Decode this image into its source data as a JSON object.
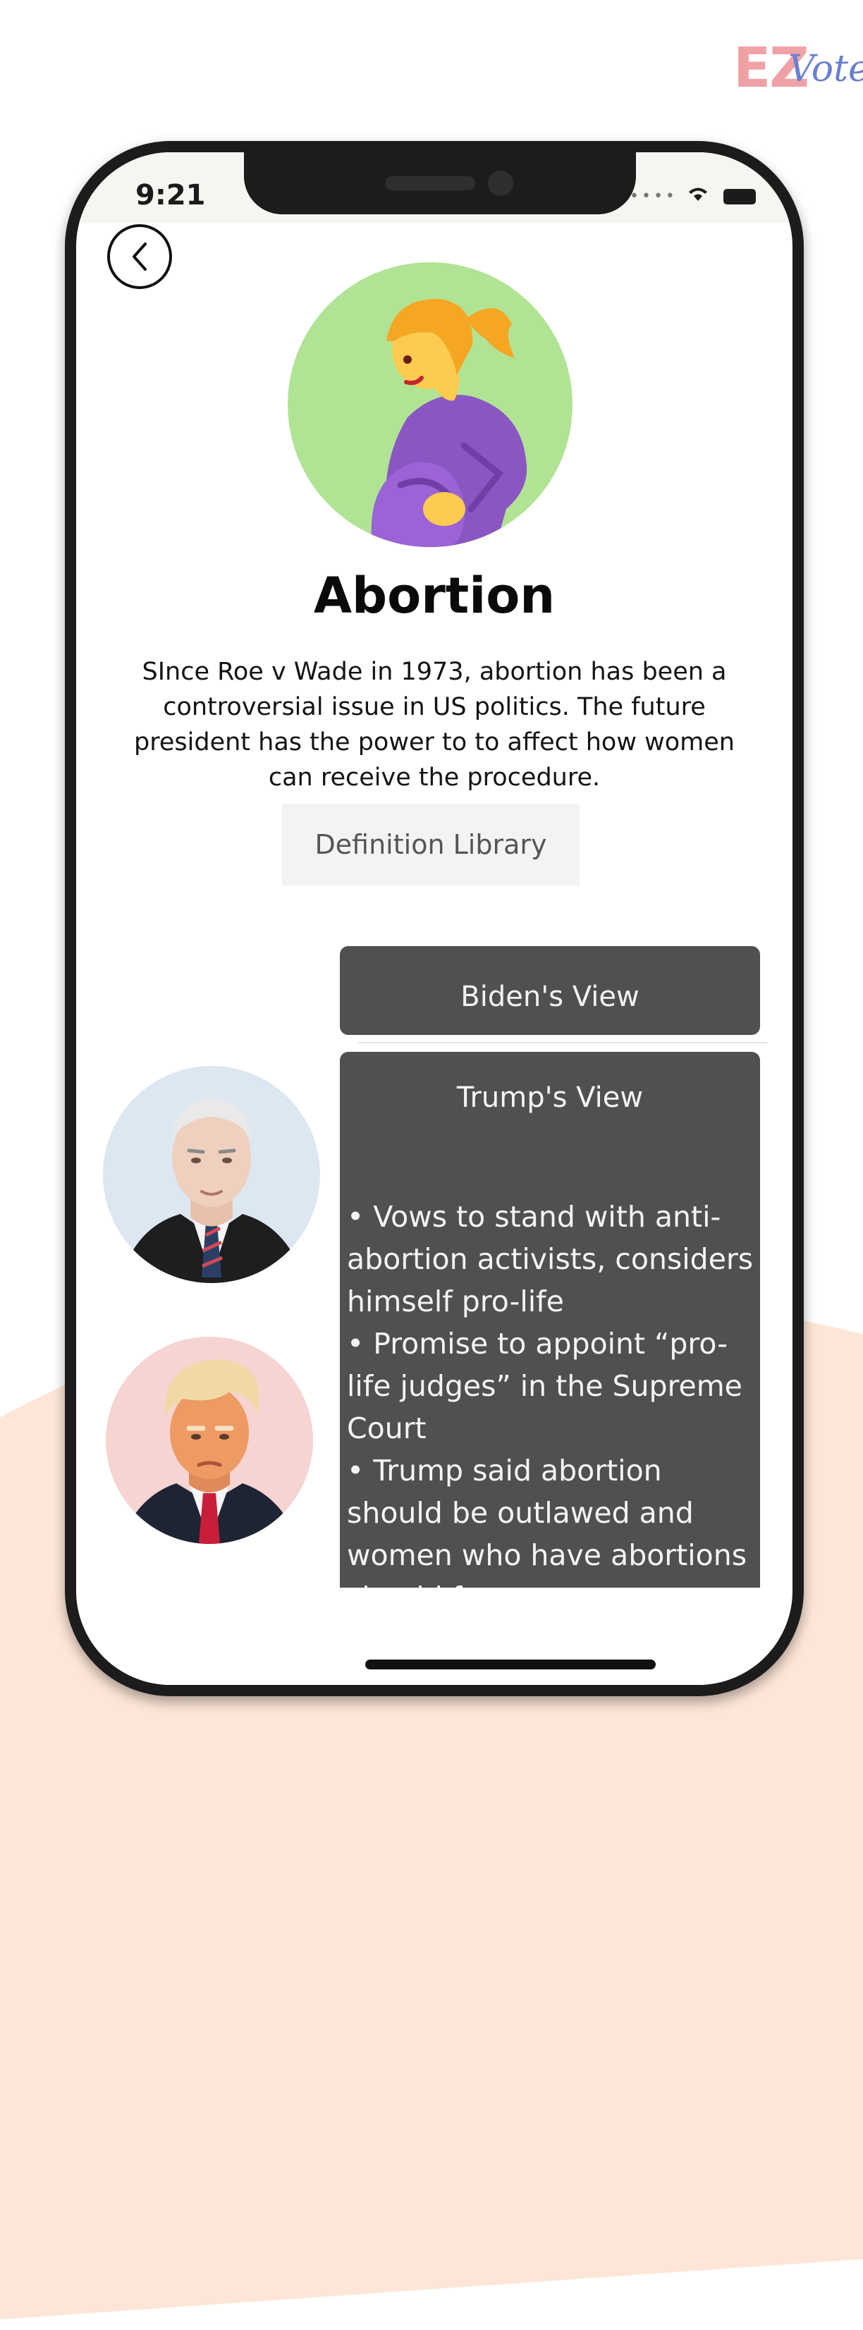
{
  "brand": {
    "logo_ez": "EZ",
    "logo_vote": "Vote",
    "accent_pink": "#efa1a6",
    "accent_blue": "#6a7fd1"
  },
  "status_bar": {
    "time": "9:21",
    "icons": [
      "signal-icon",
      "wifi-icon",
      "battery-icon"
    ]
  },
  "nav": {
    "back_icon": "chevron-left-icon"
  },
  "issue": {
    "icon": "pregnant-woman-icon",
    "title": "Abortion",
    "description": "SInce Roe v Wade in 1973, abortion has been a controversial issue in US politics. The future president has the power to to affect how women can receive the procedure.",
    "definition_button": "Definition Library"
  },
  "candidates": {
    "biden_button": "Biden's View",
    "trump_panel": {
      "title": "Trump's View",
      "points": [
        "• Vows to stand with anti-abortion activists, considers himself pro-life",
        " • Promise to appoint “pro-life judges” in the Supreme Court",
        " • Trump said abortion should be outlawed and women who have abortions should face"
      ]
    }
  },
  "colors": {
    "panel": "#505050",
    "background_blob": "#fde6d7",
    "hero_circle": "#b1e394"
  }
}
